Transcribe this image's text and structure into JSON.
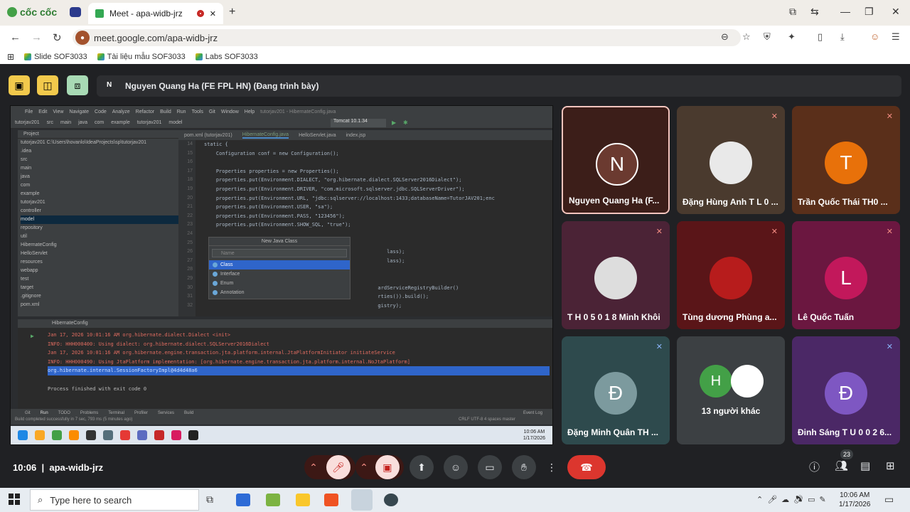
{
  "browser": {
    "brand": "cốc cốc",
    "tab_title": "Meet - apa-widb-jrz",
    "url": "meet.google.com/apa-widb-jrz",
    "bookmarks": [
      "Slide SOF3033",
      "Tài liệu mẫu SOF3033",
      "Labs SOF3033"
    ]
  },
  "meet": {
    "presenter_initial": "N",
    "presenter_label": "Nguyen Quang Ha (FE FPL HN) (Đang trình bày)",
    "meeting_time": "10:06",
    "meeting_code": "apa-widb-jrz",
    "participant_count": "23",
    "participants": [
      {
        "name": "Nguyen Quang Ha (F...",
        "initial": "N",
        "color": "#6b3a30",
        "bg": "#3c1e19"
      },
      {
        "name": "Đặng Hùng Anh T L 0 ...",
        "initial": "",
        "color": "#e9e9e9",
        "bg": "#4a3a2e"
      },
      {
        "name": "Trần Quốc Thái TH0 ...",
        "initial": "T",
        "color": "#e8710a",
        "bg": "#5a2f1a"
      },
      {
        "name": "T H 0 5 0 1 8 Minh Khôi",
        "initial": "",
        "color": "#ddd",
        "bg": "#4b2336"
      },
      {
        "name": "Tùng dương Phùng a...",
        "initial": "",
        "color": "#b71c1c",
        "bg": "#5a1518"
      },
      {
        "name": "Lê Quốc Tuấn",
        "initial": "L",
        "color": "#c2185b",
        "bg": "#6b1740"
      },
      {
        "name": "Đặng Minh Quân TH ...",
        "initial": "Đ",
        "color": "#7c9a9e",
        "bg": "#2e4a4d"
      },
      {
        "name": "13 người khác",
        "initial": "H",
        "color": "#43a047",
        "bg": "#3c4043"
      },
      {
        "name": "Đinh Sáng T U 0 0 2 6...",
        "initial": "Đ",
        "color": "#7e57c2",
        "bg": "#4b2866"
      }
    ]
  },
  "ide": {
    "menu": [
      "File",
      "Edit",
      "View",
      "Navigate",
      "Code",
      "Analyze",
      "Refactor",
      "Build",
      "Run",
      "Tools",
      "Git",
      "Window",
      "Help",
      "tutorjav201 - HibernateConfig.java"
    ],
    "breadcrumb": [
      "tutorjav201",
      "src",
      "main",
      "java",
      "com",
      "example",
      "tutorjav201",
      "model"
    ],
    "run_config": "Tomcat 10.1.34",
    "project_header": "Project",
    "tree": [
      "tutorjav201  C:\\Users\\hovanlo\\IdeaProjects\\sp\\tutorjav201",
      "  .idea",
      "  src",
      "    main",
      "      java",
      "        com",
      "          example",
      "            tutorjav201",
      "              controller",
      "              model",
      "              repository",
      "              util",
      "                HibernateConfig",
      "              HelloServlet",
      "      resources",
      "      webapp",
      "    test",
      "  target",
      "  .gitignore",
      "  pom.xml"
    ],
    "tabs": [
      "pom.xml (tutorjav201)",
      "HibernateConfig.java",
      "HelloServlet.java",
      "index.jsp"
    ],
    "gutter": [
      "14",
      "15",
      "16",
      "17",
      "18",
      "19",
      "20",
      "21",
      "22",
      "23",
      "24",
      "25",
      "26",
      "27",
      "28",
      "29",
      "30",
      "31",
      "32"
    ],
    "code": [
      "static {",
      "    Configuration conf = new Configuration();",
      "",
      "    Properties properties = new Properties();",
      "    properties.put(Environment.DIALECT, \"org.hibernate.dialect.SQLServer2016Dialect\");",
      "    properties.put(Environment.DRIVER, \"com.microsoft.sqlserver.jdbc.SQLServerDriver\");",
      "    properties.put(Environment.URL, \"jdbc:sqlserver://localhost:1433;databaseName=TutorJAV201;enc",
      "    properties.put(Environment.USER, \"sa\");",
      "    properties.put(Environment.PASS, \"123456\");",
      "    properties.put(Environment.SHOW_SQL, \"true\");",
      "",
      "",
      "                                                             lass);",
      "                                                             lass);",
      "",
      "",
      "                                                          ardServiceRegistryBuilder()",
      "                                                          rties()).build();",
      "                                                          gistry);"
    ],
    "popup": {
      "title": "New Java Class",
      "placeholder": "Name",
      "options": [
        "Class",
        "Interface",
        "Enum",
        "Annotation"
      ]
    },
    "run_tab": "HibernateConfig",
    "run_lines": [
      "Jan 17, 2026 10:01:16 AM org.hibernate.dialect.Dialect <init>",
      "INFO: HHH000400: Using dialect: org.hibernate.dialect.SQLServer2016Dialect",
      "Jan 17, 2026 10:01:16 AM org.hibernate.engine.transaction.jta.platform.internal.JtaPlatformInitiator initiateService",
      "INFO: HHH000490: Using JtaPlatform implementation: [org.hibernate.engine.transaction.jta.platform.internal.NoJtaPlatform]",
      "org.hibernate.internal.SessionFactoryImpl@4d4d48a6",
      "",
      "Process finished with exit code 0"
    ],
    "bottom_tabs": [
      "Git",
      "Run",
      "TODO",
      "Problems",
      "Terminal",
      "Profiler",
      "Services",
      "Build",
      "Event Log"
    ],
    "status": "Build completed successfully in 7 sec, 793 ms (5 minutes ago)",
    "status_right": "CRLF   UTF-8   4 spaces   master",
    "clock_time": "10:06 AM",
    "clock_date": "1/17/2026"
  },
  "taskbar": {
    "search_placeholder": "Type here to search",
    "time": "10:06 AM",
    "date": "1/17/2026"
  }
}
